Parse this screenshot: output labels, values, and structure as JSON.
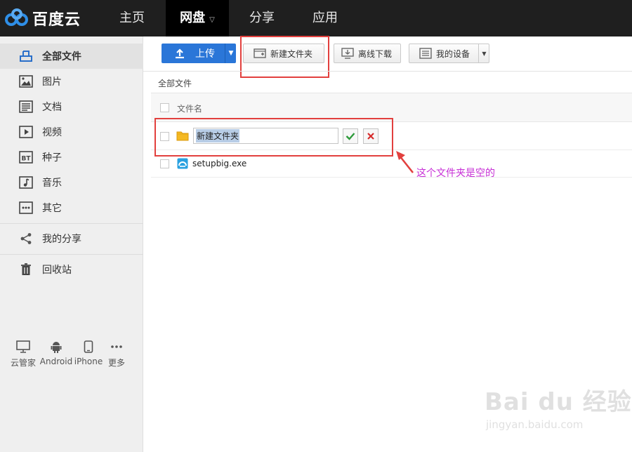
{
  "header": {
    "logo_text": "百度云",
    "nav": [
      "主页",
      "网盘",
      "分享",
      "应用"
    ],
    "active_nav": "网盘"
  },
  "sidebar": {
    "items": [
      {
        "label": "全部文件",
        "icon": "upload-box-icon",
        "active": true
      },
      {
        "label": "图片",
        "icon": "image-icon"
      },
      {
        "label": "文档",
        "icon": "document-icon"
      },
      {
        "label": "视频",
        "icon": "video-icon"
      },
      {
        "label": "种子",
        "icon": "bt-icon"
      },
      {
        "label": "音乐",
        "icon": "music-icon"
      },
      {
        "label": "其它",
        "icon": "more-icon"
      },
      {
        "label": "我的分享",
        "icon": "share-icon"
      },
      {
        "label": "回收站",
        "icon": "trash-icon"
      }
    ],
    "devices": [
      {
        "label": "云管家",
        "icon": "monitor-icon"
      },
      {
        "label": "Android",
        "icon": "android-icon"
      },
      {
        "label": "iPhone",
        "icon": "phone-icon"
      },
      {
        "label": "更多",
        "icon": "ellipsis-icon"
      }
    ]
  },
  "toolbar": {
    "upload_label": "上传",
    "new_folder_label": "新建文件夹",
    "offline_download_label": "离线下载",
    "my_devices_label": "我的设备"
  },
  "breadcrumb": "全部文件",
  "file_list": {
    "column_name": "文件名",
    "rename_value": "新建文件夹",
    "files": [
      "setupbig.exe"
    ]
  },
  "annotation": {
    "text": "这个文件夹是空的",
    "color": "#c72fd6",
    "highlight_color": "#e2403e"
  },
  "watermark": {
    "main": "Bai du 经验",
    "sub": "jingyan.baidu.com"
  },
  "colors": {
    "topbar": "#1f1f1f",
    "primary": "#2a76d8",
    "sidebar": "#efefef"
  }
}
